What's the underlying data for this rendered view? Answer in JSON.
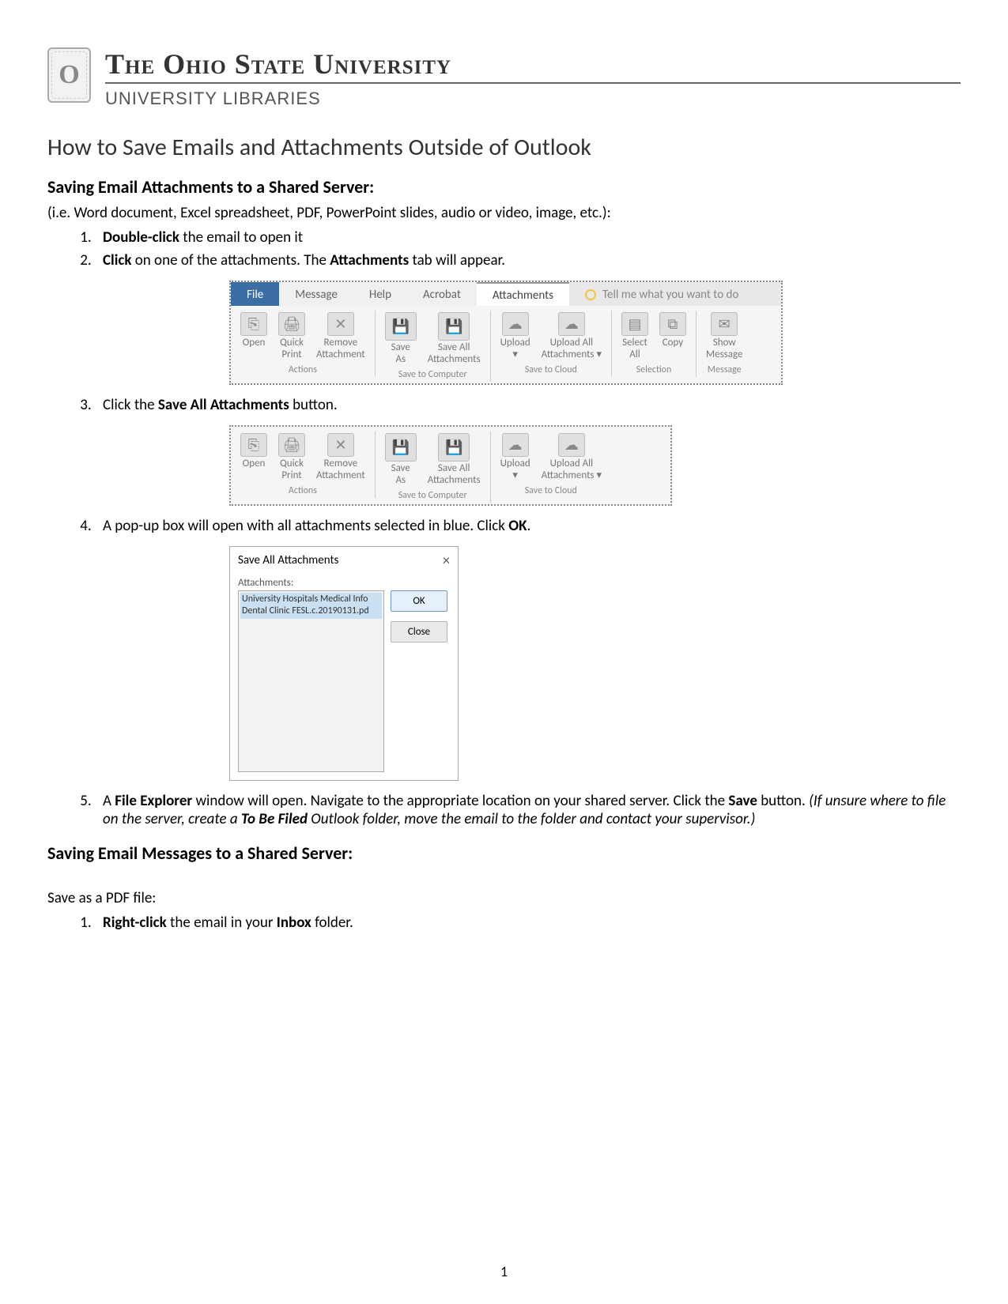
{
  "header": {
    "logo_letter": "O",
    "university": "The Ohio State University",
    "subunit": "UNIVERSITY LIBRARIES"
  },
  "page_title": "How to Save Emails and Attachments Outside of Outlook",
  "section1": {
    "title": "Saving Email Attachments to a Shared Server:",
    "intro": "(i.e. Word document, Excel spreadsheet, PDF, PowerPoint slides, audio or video, image, etc.):",
    "steps": {
      "s1a": "Double-click",
      "s1b": " the email to open it",
      "s2a": "Click",
      "s2b": " on one of the attachments.  The ",
      "s2c": "Attachments",
      "s2d": " tab will appear.",
      "s3a": "Click the ",
      "s3b": "Save All Attachments",
      "s3c": " button.",
      "s4a": "A pop-up box will open with all attachments selected in blue.  Click ",
      "s4b": "OK",
      "s4c": ".",
      "s5a": "A ",
      "s5b": "File Explorer",
      "s5c": " window will open.  Navigate to the appropriate location on your shared server.  Click the ",
      "s5d": "Save",
      "s5e": " button.  ",
      "s5f": "(If unsure where to file on the server, create a ",
      "s5g": "To Be Filed",
      "s5h": " Outlook folder, move the email to the folder and contact your supervisor.)"
    }
  },
  "ribbon": {
    "tabs": {
      "file": "File",
      "message": "Message",
      "help": "Help",
      "acrobat": "Acrobat",
      "attachments": "Attachments",
      "tell_me": "Tell me what you want to do"
    },
    "groups": {
      "actions": {
        "open": "Open",
        "quick_print_l1": "Quick",
        "quick_print_l2": "Print",
        "remove_l1": "Remove",
        "remove_l2": "Attachment",
        "label": "Actions"
      },
      "save_computer": {
        "save_as_l1": "Save",
        "save_as_l2": "As",
        "save_all_l1": "Save All",
        "save_all_l2": "Attachments",
        "label": "Save to Computer"
      },
      "save_cloud": {
        "upload": "Upload",
        "upload_dd": "▾",
        "upload_all_l1": "Upload All",
        "upload_all_l2": "Attachments ▾",
        "label": "Save to Cloud"
      },
      "selection": {
        "select_all_l1": "Select",
        "select_all_l2": "All",
        "copy": "Copy",
        "label": "Selection"
      },
      "message": {
        "show_l1": "Show",
        "show_l2": "Message",
        "label": "Message"
      }
    }
  },
  "dialog": {
    "title": "Save All Attachments",
    "label": "Attachments:",
    "selected_item_l1": "University Hospitals Medical Info",
    "selected_item_l2": "Dental Clinic FESL.c.20190131.pd",
    "ok": "OK",
    "close": "Close"
  },
  "section2": {
    "title": "Saving Email Messages to a Shared Server:",
    "sub": "Save as a PDF file:",
    "steps": {
      "s1a": "Right-click",
      "s1b": " the email in your ",
      "s1c": "Inbox",
      "s1d": " folder."
    }
  },
  "page_number": "1"
}
